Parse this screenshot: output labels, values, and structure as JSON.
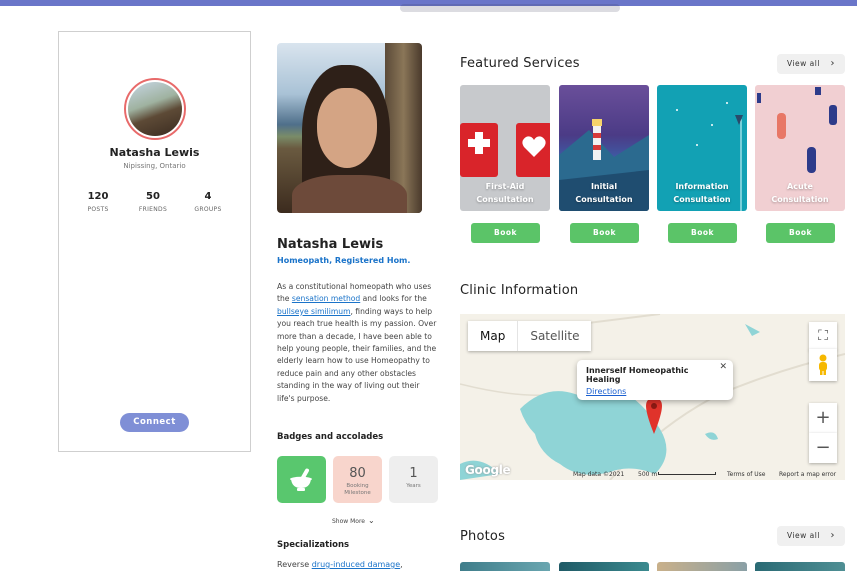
{
  "profile": {
    "name": "Natasha Lewis",
    "location": "Nipissing, Ontario",
    "stats": [
      {
        "value": "120",
        "label": "POSTS"
      },
      {
        "value": "50",
        "label": "FRIENDS"
      },
      {
        "value": "4",
        "label": "GROUPS"
      }
    ],
    "connect_label": "Connect"
  },
  "about": {
    "name": "Natasha Lewis",
    "title": "Homeopath, Registered Hom.",
    "bio_1": "As a constitutional homeopath who uses the ",
    "bio_link_1": "sensation method",
    "bio_2": " and looks for the ",
    "bio_link_2": "bullseye similimum",
    "bio_3": ", finding ways to help you reach true health is my passion. Over more than a decade, I have been able to help young people, their families, and the elderly learn how to use Homeopathy to reduce pain and any other obstacles standing in the way of living out their life's purpose.",
    "badges_heading": "Badges and accolades",
    "badges": [
      {
        "value": "",
        "label": "",
        "icon": "mortar-pestle-icon"
      },
      {
        "value": "80",
        "label": "Booking Milestone"
      },
      {
        "value": "1",
        "label": "Years"
      }
    ],
    "show_more": "Show More",
    "specializations_heading": "Specializations",
    "spec_prefix": "Reverse ",
    "spec_link": "drug-induced damage",
    "spec_suffix": ","
  },
  "services": {
    "heading": "Featured Services",
    "view_all": "View all",
    "items": [
      {
        "label_1": "First-Aid",
        "label_2": "Consultation",
        "book": "Book"
      },
      {
        "label_1": "Initial",
        "label_2": "Consultation",
        "book": "Book"
      },
      {
        "label_1": "Information",
        "label_2": "Consultation",
        "book": "Book"
      },
      {
        "label_1": "Acute",
        "label_2": "Consultation",
        "book": "Book"
      }
    ]
  },
  "clinic": {
    "heading": "Clinic Information",
    "map_tab": "Map",
    "satellite_tab": "Satellite",
    "popup_title": "Innerself Homeopathic Healing",
    "popup_link": "Directions",
    "zoom_in": "+",
    "zoom_out": "−",
    "map_data": "Map data ©2021",
    "scale": "500 m",
    "terms": "Terms of Use",
    "report": "Report a map error",
    "google": "Google"
  },
  "photos": {
    "heading": "Photos",
    "view_all": "View all"
  },
  "colors": {
    "accent": "#1a73c9",
    "book_green": "#5bc468",
    "connect": "#7f8fd6",
    "topbar": "#6a76c9"
  }
}
